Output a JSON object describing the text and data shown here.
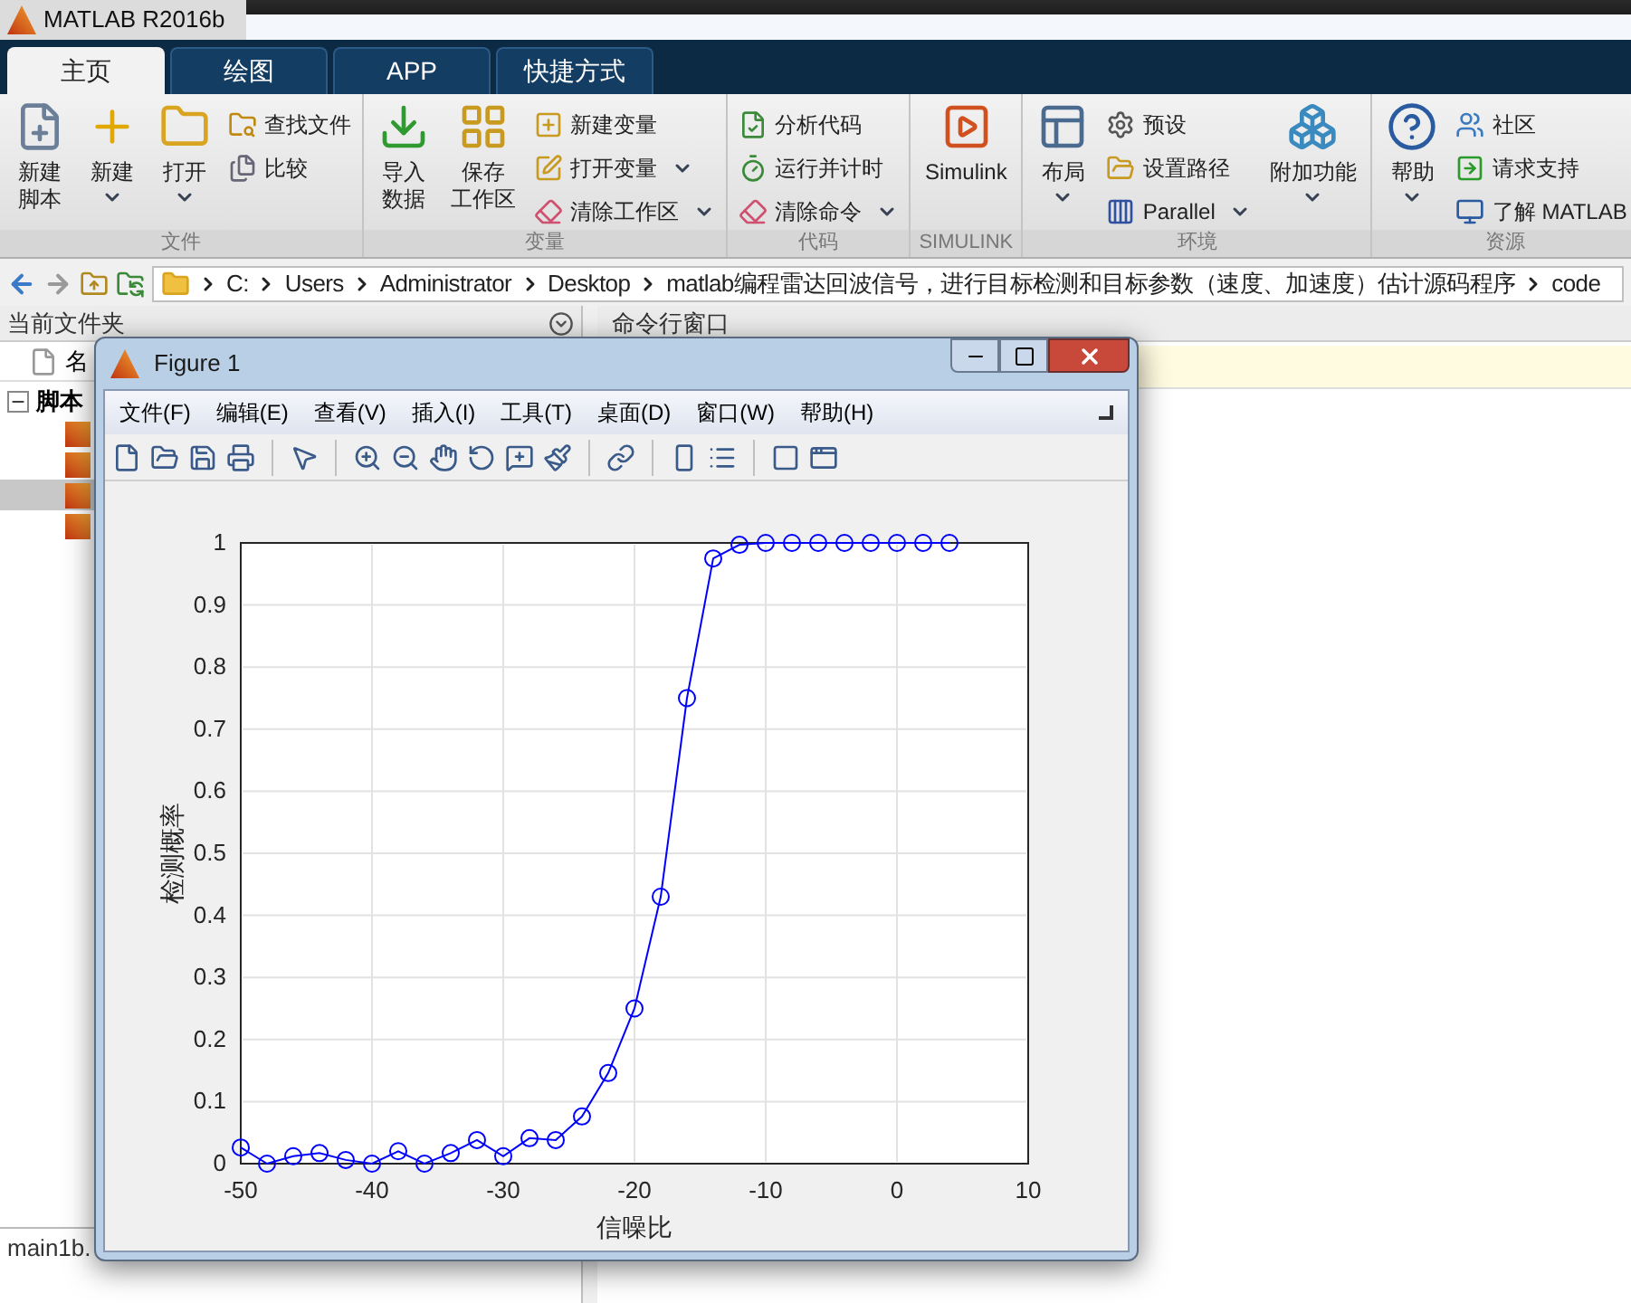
{
  "window": {
    "title": "MATLAB R2016b"
  },
  "tabs": [
    {
      "label": "主页",
      "selected": true
    },
    {
      "label": "绘图",
      "selected": false
    },
    {
      "label": "APP",
      "selected": false
    },
    {
      "label": "快捷方式",
      "selected": false
    }
  ],
  "ribbon": [
    {
      "label": "文件",
      "items": [
        {
          "kind": "large",
          "lines": [
            "新建",
            "脚本"
          ],
          "dropdown": false
        },
        {
          "kind": "large",
          "lines": [
            "新建"
          ],
          "dropdown": true
        },
        {
          "kind": "large",
          "lines": [
            "打开"
          ],
          "dropdown": true
        },
        {
          "kind": "small",
          "label": "查找文件",
          "dropdown": false
        },
        {
          "kind": "small",
          "label": "比较",
          "dropdown": false
        }
      ]
    },
    {
      "label": "变量",
      "items": [
        {
          "kind": "large",
          "lines": [
            "导入",
            "数据"
          ],
          "dropdown": false
        },
        {
          "kind": "large",
          "lines": [
            "保存",
            "工作区"
          ],
          "dropdown": false
        },
        {
          "kind": "small",
          "label": "新建变量",
          "dropdown": false
        },
        {
          "kind": "small",
          "label": "打开变量",
          "dropdown": true
        },
        {
          "kind": "small",
          "label": "清除工作区",
          "dropdown": true
        }
      ]
    },
    {
      "label": "代码",
      "items": [
        {
          "kind": "small",
          "label": "分析代码",
          "dropdown": false
        },
        {
          "kind": "small",
          "label": "运行并计时",
          "dropdown": false
        },
        {
          "kind": "small",
          "label": "清除命令",
          "dropdown": true
        }
      ]
    },
    {
      "label": "SIMULINK",
      "items": [
        {
          "kind": "large",
          "lines": [
            "Simulink"
          ],
          "dropdown": false
        }
      ]
    },
    {
      "label": "环境",
      "items": [
        {
          "kind": "large",
          "lines": [
            "布局"
          ],
          "dropdown": true
        },
        {
          "kind": "small",
          "label": "预设",
          "dropdown": false
        },
        {
          "kind": "small",
          "label": "设置路径",
          "dropdown": false
        },
        {
          "kind": "small",
          "label": "Parallel",
          "dropdown": true
        },
        {
          "kind": "large",
          "lines": [
            "附加功能"
          ],
          "dropdown": true
        }
      ]
    },
    {
      "label": "资源",
      "items": [
        {
          "kind": "large",
          "lines": [
            "帮助"
          ],
          "dropdown": true
        },
        {
          "kind": "small",
          "label": "社区",
          "dropdown": false
        },
        {
          "kind": "small",
          "label": "请求支持",
          "dropdown": false
        },
        {
          "kind": "small",
          "label": "了解 MATLAB",
          "dropdown": false
        }
      ]
    }
  ],
  "address": [
    "C:",
    "Users",
    "Administrator",
    "Desktop",
    "matlab编程雷达回波信号，进行目标检测和目标参数（速度、加速度）估计源码程序",
    "code"
  ],
  "current_folder": {
    "title": "当前文件夹",
    "column_1": "名",
    "group": "脚本",
    "files": [
      {
        "selected": false
      },
      {
        "selected": false
      },
      {
        "selected": true
      },
      {
        "selected": false
      }
    ],
    "details": "main1b."
  },
  "command_window": {
    "title": "命令行窗口"
  },
  "figure": {
    "title": "Figure 1",
    "menu": [
      "文件(F)",
      "编辑(E)",
      "查看(V)",
      "插入(I)",
      "工具(T)",
      "桌面(D)",
      "窗口(W)",
      "帮助(H)"
    ],
    "chart_data": {
      "type": "line",
      "xlabel": "信噪比",
      "ylabel": "检测概率",
      "xlim": [
        -50,
        10
      ],
      "ylim": [
        0,
        1
      ],
      "xticks": [
        -50,
        -40,
        -30,
        -20,
        -10,
        0,
        10
      ],
      "yticks": [
        0,
        0.1,
        0.2,
        0.3,
        0.4,
        0.5,
        0.6,
        0.7,
        0.8,
        0.9,
        1
      ],
      "x": [
        -50,
        -48,
        -46,
        -44,
        -42,
        -40,
        -38,
        -36,
        -34,
        -32,
        -30,
        -28,
        -26,
        -24,
        -22,
        -20,
        -18,
        -16,
        -14,
        -12,
        -10,
        -8,
        -6,
        -4,
        -2,
        0,
        2,
        4
      ],
      "grid": true,
      "series": [
        {
          "marker": "o",
          "color": "#0000ff",
          "values": [
            0.026,
            0,
            0.012,
            0.017,
            0.006,
            0,
            0.02,
            0,
            0.017,
            0.038,
            0.012,
            0.041,
            0.038,
            0.076,
            0.146,
            0.25,
            0.43,
            0.75,
            0.975,
            0.997,
            1,
            1,
            1,
            1,
            1,
            1,
            1,
            1
          ]
        }
      ]
    }
  }
}
